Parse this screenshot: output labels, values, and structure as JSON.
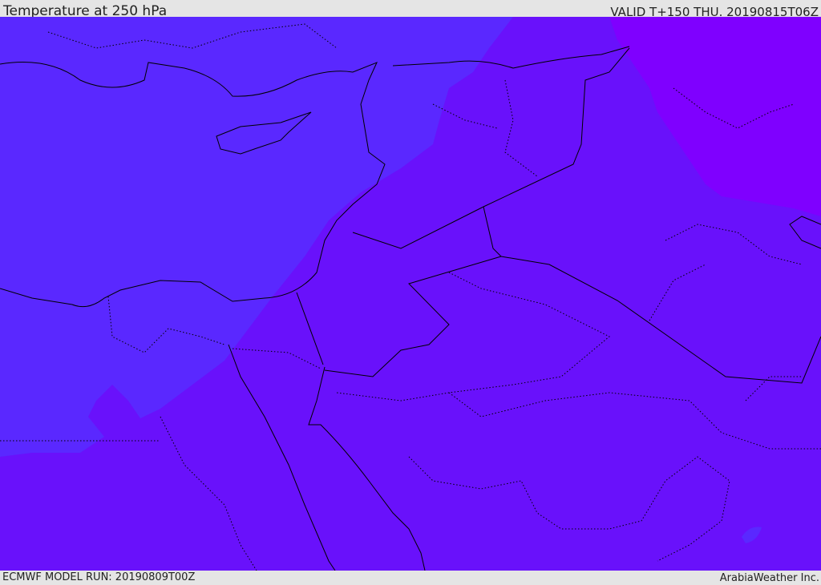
{
  "header": {
    "title": "Temperature at 250 hPa",
    "valid": "VALID T+150 THU. 20190815T06Z"
  },
  "footer": {
    "model_run": "ECMWF MODEL RUN: 20190809T00Z",
    "brand": "ArabiaWeather Inc."
  },
  "colors": {
    "cooler_band": "#5a28ff",
    "mid_band": "#6911fb",
    "warm_band": "#7f00ff",
    "border": "#000000"
  }
}
